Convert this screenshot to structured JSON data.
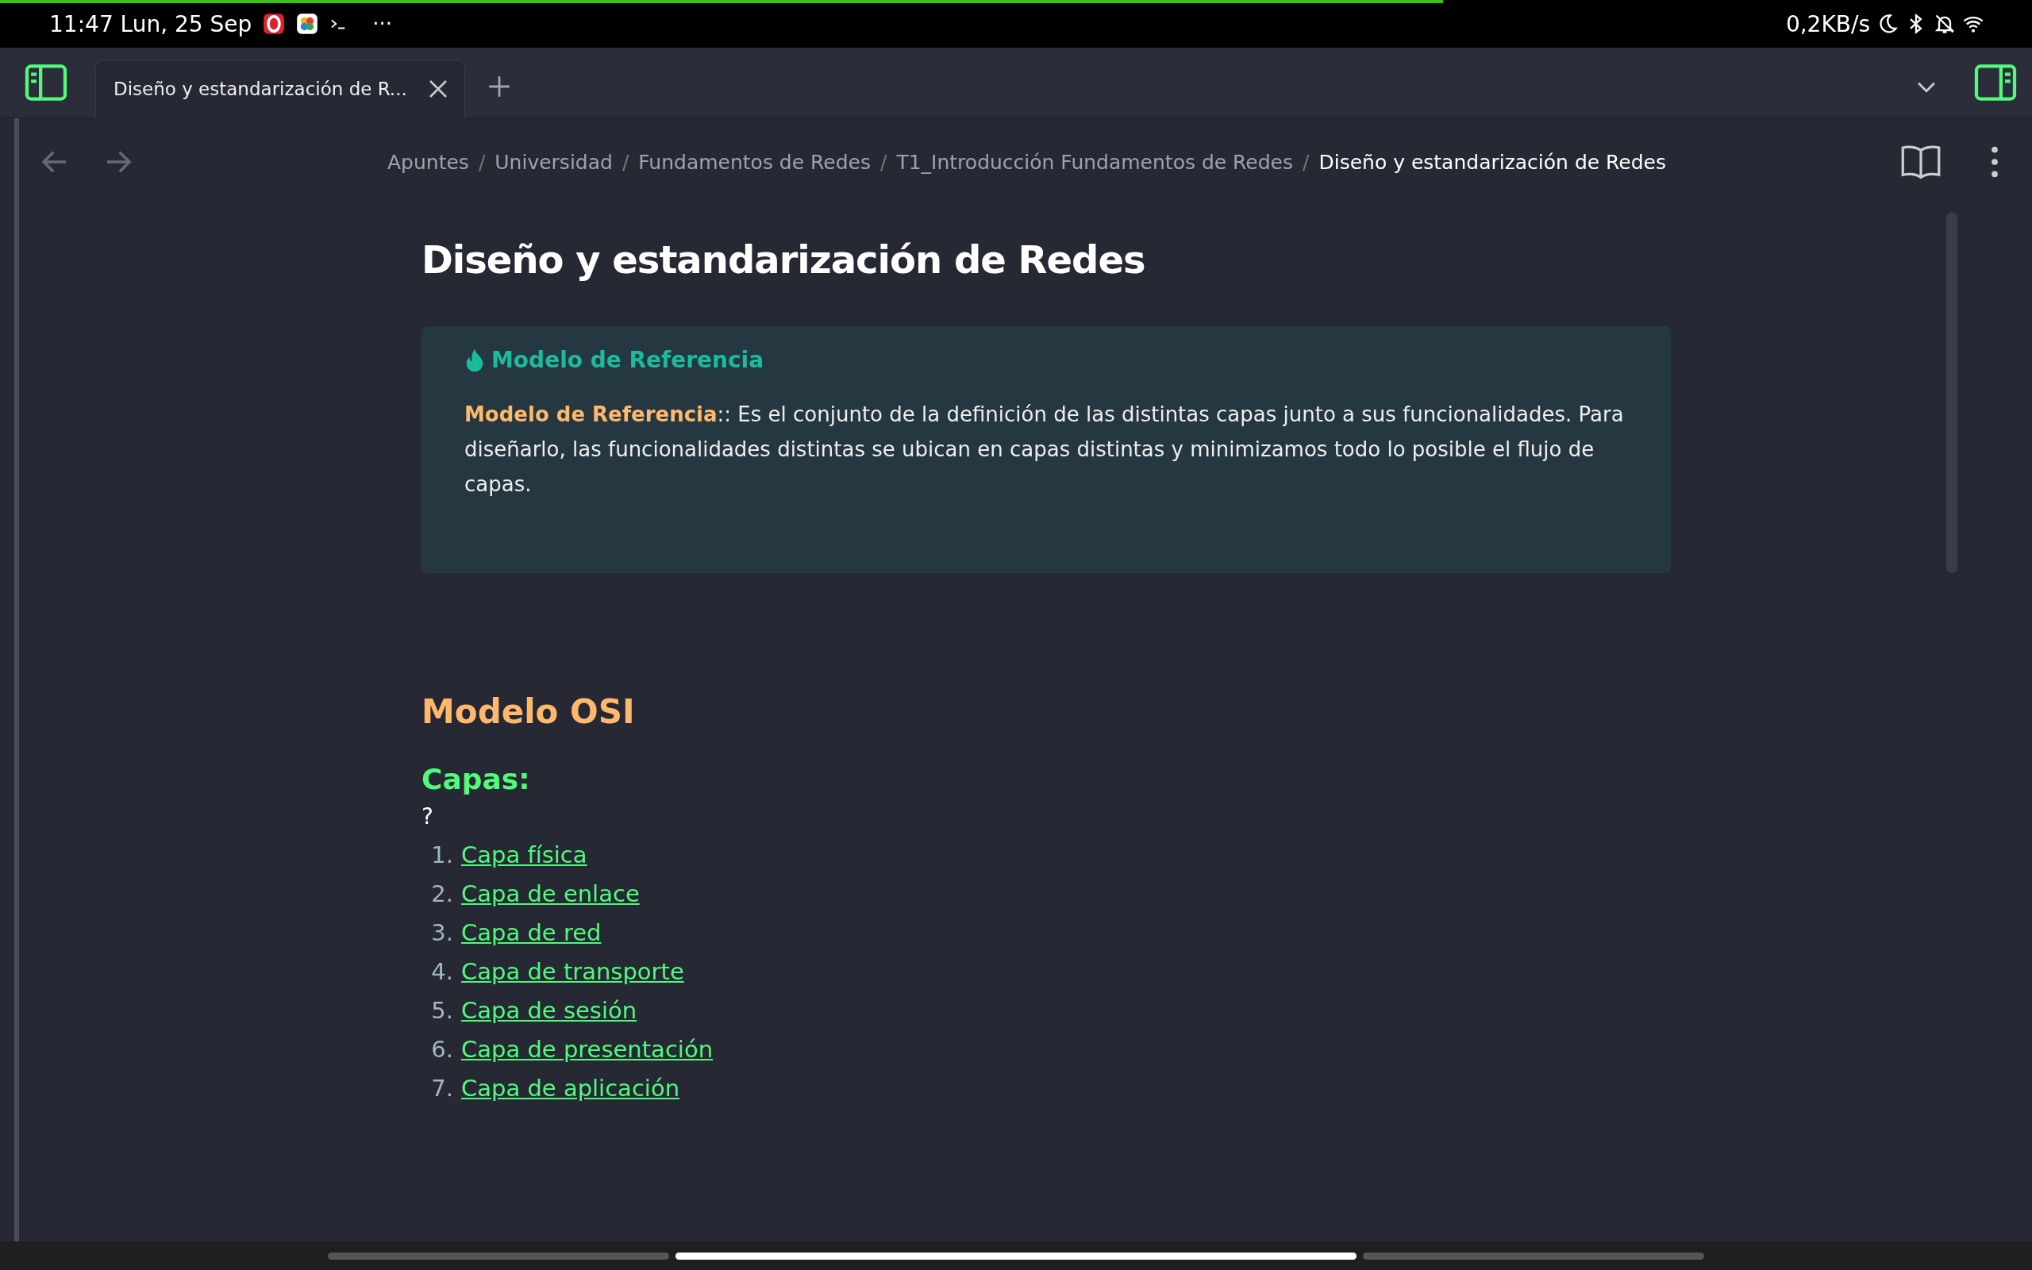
{
  "status_bar": {
    "time": "11:47 Lun, 25 Sep",
    "overflow": "···",
    "network_speed": "0,2KB/s",
    "level": 0.71
  },
  "tabs": [
    {
      "label": "Diseño y estandarización de R...",
      "selected": true
    }
  ],
  "breadcrumbs": [
    {
      "label": "Apuntes"
    },
    {
      "separator": "/",
      "label": "Universidad"
    },
    {
      "separator": "/",
      "label": "Fundamentos de Redes"
    },
    {
      "separator": "/",
      "label": "T1_Introducción Fundamentos de Redes"
    },
    {
      "separator": "/",
      "label": "Diseño y estandarización de Redes"
    }
  ],
  "note": {
    "title": "Diseño y estandarización de Redes",
    "callout": {
      "title": "Modelo de Referencia",
      "text": "**Modelo de Referencia**:: Es el conjunto de la definición de las distintas capas junto a sus funcionalidades. Para diseñarlo, las funcionalidades distintas se ubican en capas distintas y minimizamos todo lo posible el flujo de capas."
    },
    "heading": "Modelo OSI",
    "subheading": "Capas:",
    "paragraph": "?",
    "list": [
      {
        "number": "1.",
        "link": "Capa física"
      },
      {
        "number": "2.",
        "link": "Capa de enlace"
      },
      {
        "number": "3.",
        "link": "Capa de red"
      },
      {
        "number": "4.",
        "link": "Capa de transporte"
      },
      {
        "number": "5.",
        "link": "Capa de sesión"
      },
      {
        "number": "6.",
        "link": "Capa de presentación"
      },
      {
        "number": "7.",
        "link": "Capa de aplicación"
      }
    ]
  }
}
